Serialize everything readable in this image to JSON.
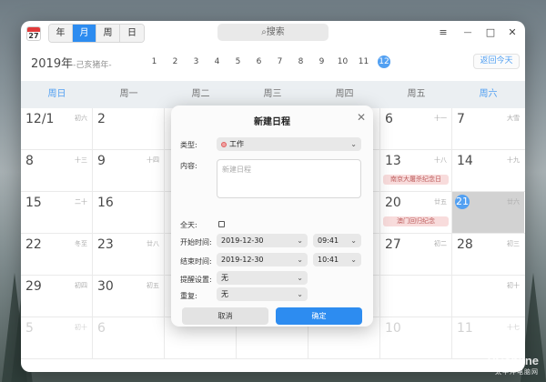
{
  "app": {
    "icon_day": "27",
    "accent": "#2d8cf0"
  },
  "view_tabs": [
    {
      "label": "年",
      "active": false
    },
    {
      "label": "月",
      "active": true
    },
    {
      "label": "周",
      "active": false
    },
    {
      "label": "日",
      "active": false
    }
  ],
  "search": {
    "icon": "search-icon",
    "placeholder": "搜索"
  },
  "window_controls": {
    "menu": "≡",
    "minimize": "—",
    "maximize": "□",
    "close": "✕"
  },
  "header": {
    "year_title": "2019年",
    "year_sub": "-己亥猪年-",
    "months": [
      "1",
      "2",
      "3",
      "4",
      "5",
      "6",
      "7",
      "8",
      "9",
      "10",
      "11",
      "12"
    ],
    "active_month": "12",
    "today_button": "返回今天"
  },
  "weekdays": [
    "周日",
    "周一",
    "周二",
    "周三",
    "周四",
    "周五",
    "周六"
  ],
  "calendar": {
    "weeks": [
      [
        {
          "d": "12/1",
          "l": "初六"
        },
        {
          "d": "2",
          "l": ""
        },
        {
          "d": "",
          "l": ""
        },
        {
          "d": "",
          "l": ""
        },
        {
          "d": "",
          "l": ""
        },
        {
          "d": "6",
          "l": "十一"
        },
        {
          "d": "7",
          "l": "大雪"
        }
      ],
      [
        {
          "d": "8",
          "l": "十三"
        },
        {
          "d": "9",
          "l": "十四"
        },
        {
          "d": "",
          "l": ""
        },
        {
          "d": "",
          "l": ""
        },
        {
          "d": "",
          "l": ""
        },
        {
          "d": "13",
          "l": "十八",
          "event": "南京大屠杀纪念日"
        },
        {
          "d": "14",
          "l": "十九"
        }
      ],
      [
        {
          "d": "15",
          "l": "二十"
        },
        {
          "d": "16",
          "l": ""
        },
        {
          "d": "",
          "l": ""
        },
        {
          "d": "",
          "l": ""
        },
        {
          "d": "",
          "l": ""
        },
        {
          "d": "20",
          "l": "廿五",
          "event": "澳门回归纪念"
        },
        {
          "d": "21",
          "l": "廿六",
          "today": true
        }
      ],
      [
        {
          "d": "22",
          "l": "冬至"
        },
        {
          "d": "23",
          "l": "廿八"
        },
        {
          "d": "",
          "l": ""
        },
        {
          "d": "",
          "l": ""
        },
        {
          "d": "",
          "l": ""
        },
        {
          "d": "27",
          "l": "初二"
        },
        {
          "d": "28",
          "l": "初三"
        }
      ],
      [
        {
          "d": "29",
          "l": "初四"
        },
        {
          "d": "30",
          "l": "初五"
        },
        {
          "d": "",
          "l": ""
        },
        {
          "d": "",
          "l": ""
        },
        {
          "d": "",
          "l": ""
        },
        {
          "d": "",
          "l": ""
        },
        {
          "d": "",
          "l": "初十"
        }
      ],
      [
        {
          "d": "5",
          "l": "初十",
          "dim": true
        },
        {
          "d": "6",
          "l": "",
          "dim": true
        },
        {
          "d": "",
          "l": ""
        },
        {
          "d": "",
          "l": ""
        },
        {
          "d": "",
          "l": ""
        },
        {
          "d": "10",
          "l": "",
          "dim": true
        },
        {
          "d": "11",
          "l": "十七",
          "dim": true
        }
      ]
    ]
  },
  "dialog": {
    "title": "新建日程",
    "type_label": "类型:",
    "type_value": "工作",
    "content_label": "内容:",
    "content_placeholder": "新建日程",
    "allday_label": "全天:",
    "start_label": "开始时间:",
    "start_date": "2019-12-30",
    "start_time": "09:41",
    "end_label": "结束时间:",
    "end_date": "2019-12-30",
    "end_time": "10:41",
    "remind_label": "提醒设置:",
    "remind_value": "无",
    "repeat_label": "重复:",
    "repeat_value": "无",
    "cancel": "取消",
    "confirm": "确定"
  },
  "watermark": {
    "line1": "PConline",
    "line2": "太平洋电脑网"
  }
}
